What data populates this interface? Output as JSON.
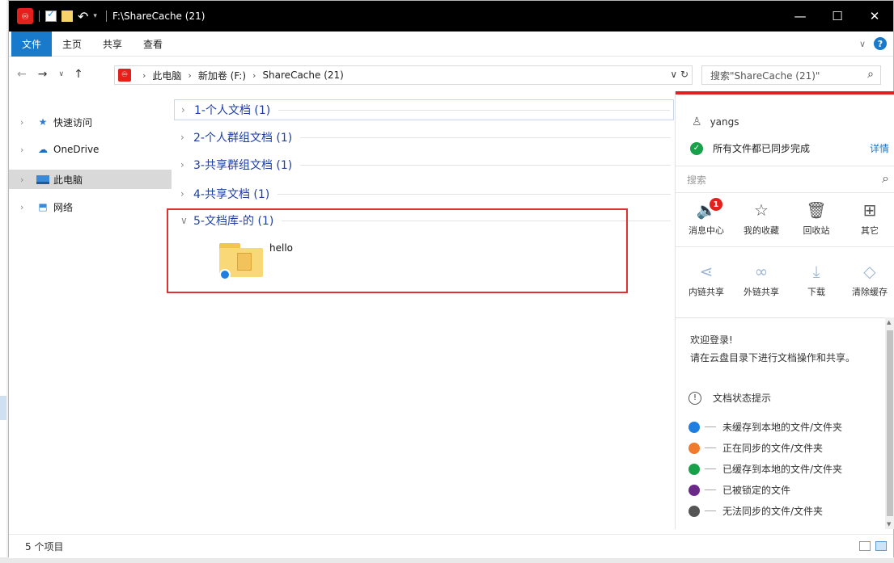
{
  "window": {
    "title": "F:\\ShareCache (21)"
  },
  "ribbon": {
    "tabs": [
      "文件",
      "主页",
      "共享",
      "查看"
    ]
  },
  "address": {
    "crumbs": [
      "此电脑",
      "新加卷 (F:)",
      "ShareCache (21)"
    ]
  },
  "search": {
    "placeholder": "搜索\"ShareCache (21)\""
  },
  "navpane": {
    "items": [
      {
        "label": "快速访问",
        "icon": "star-icon"
      },
      {
        "label": "OneDrive",
        "icon": "onedrive-icon"
      },
      {
        "label": "此电脑",
        "icon": "pc-icon"
      },
      {
        "label": "网络",
        "icon": "network-icon"
      }
    ]
  },
  "groups": [
    {
      "label": "1-个人文档 (1)",
      "expanded": false
    },
    {
      "label": "2-个人群组文档 (1)",
      "expanded": false
    },
    {
      "label": "3-共享群组文档 (1)",
      "expanded": false
    },
    {
      "label": "4-共享文档 (1)",
      "expanded": false
    },
    {
      "label": "5-文档库-的 (1)",
      "expanded": true
    }
  ],
  "file": {
    "name": "hello"
  },
  "panel": {
    "user": "yangs",
    "sync_status": "所有文件都已同步完成",
    "detail": "详情",
    "search_placeholder": "搜索",
    "tools_row1": [
      {
        "label": "消息中心",
        "icon": "speaker-icon",
        "badge": "1"
      },
      {
        "label": "我的收藏",
        "icon": "star-outline-icon"
      },
      {
        "label": "回收站",
        "icon": "trash-icon"
      },
      {
        "label": "其它",
        "icon": "grid-icon"
      }
    ],
    "tools_row2": [
      {
        "label": "内链共享",
        "icon": "share-icon"
      },
      {
        "label": "外链共享",
        "icon": "link-icon"
      },
      {
        "label": "下载",
        "icon": "download-icon"
      },
      {
        "label": "清除缓存",
        "icon": "eraser-icon"
      }
    ],
    "welcome": "欢迎登录!",
    "hint": "请在云盘目录下进行文档操作和共享。",
    "status_title": "文档状态提示",
    "legend": [
      {
        "label": "未缓存到本地的文件/文件夹",
        "color": "#1e7fe0"
      },
      {
        "label": "正在同步的文件/文件夹",
        "color": "#f07a2e"
      },
      {
        "label": "已缓存到本地的文件/文件夹",
        "color": "#19a04a"
      },
      {
        "label": "已被锁定的文件",
        "color": "#6b2a8a"
      },
      {
        "label": "无法同步的文件/文件夹",
        "color": "#555555"
      }
    ]
  },
  "status": {
    "count": "5 个项目"
  }
}
